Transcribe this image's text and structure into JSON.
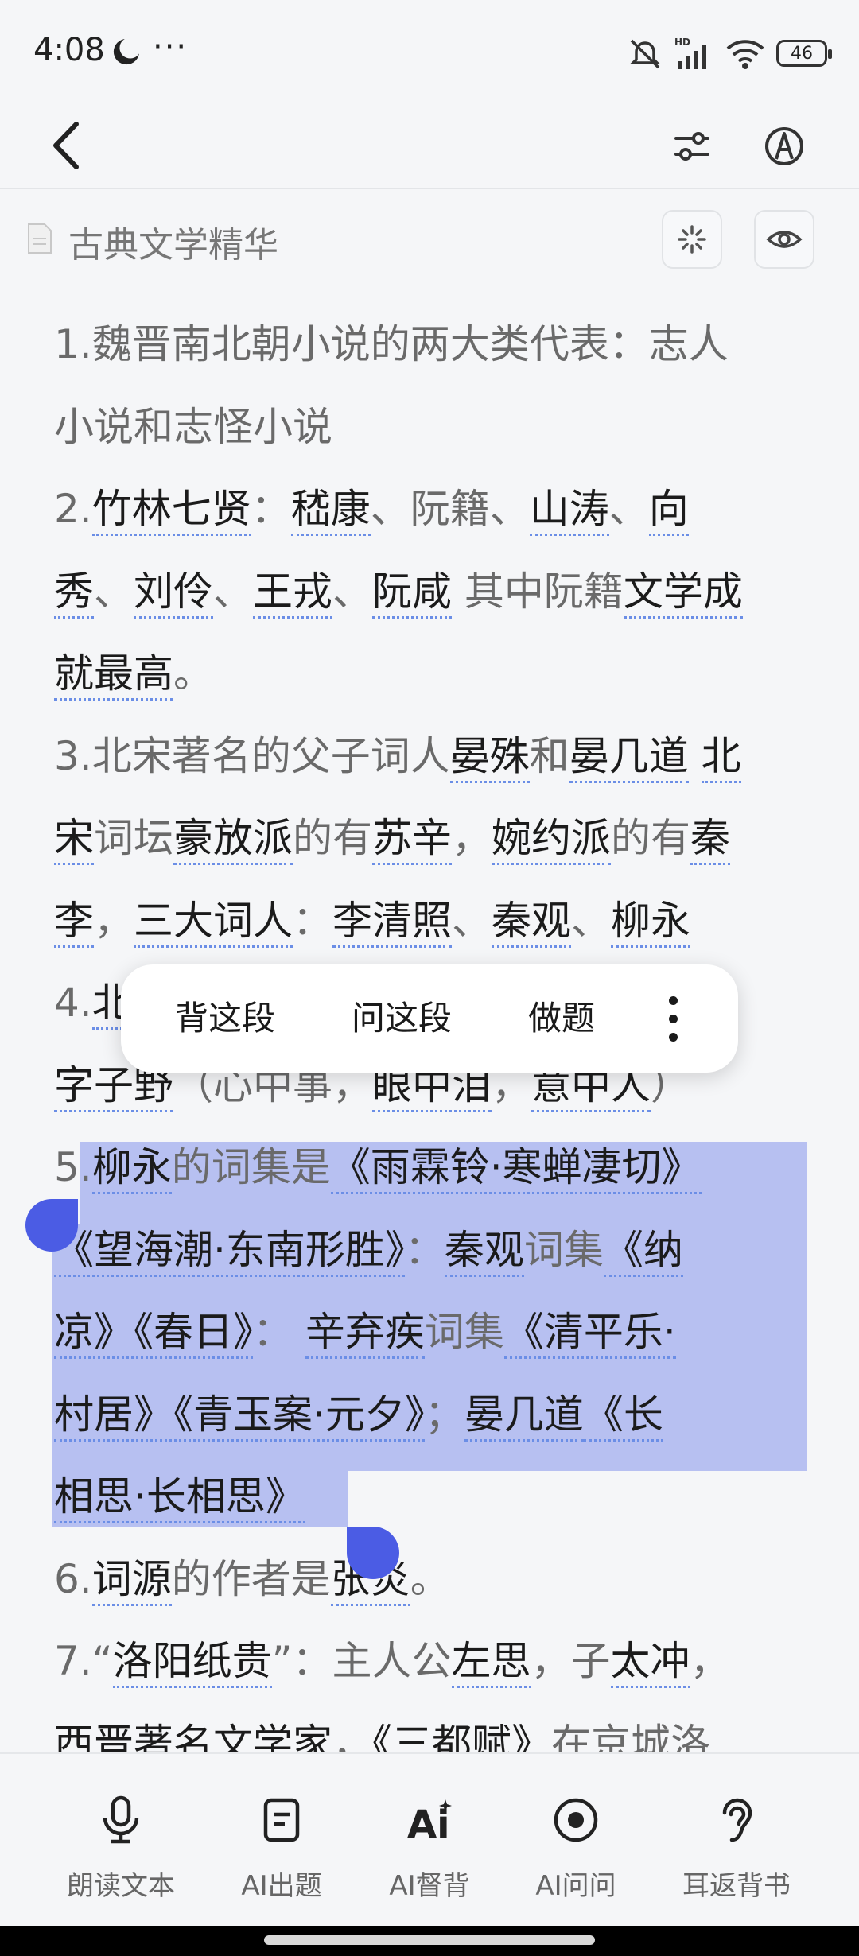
{
  "status": {
    "time": "4:08",
    "dots": "···",
    "battery": "46"
  },
  "doc": {
    "title": "古典文学精华"
  },
  "paragraphs": [
    [
      {
        "t": "1.魏晋南北朝小说的两大类代表：志人"
      }
    ],
    [
      {
        "t": "小说和志怪小说"
      }
    ],
    [
      {
        "t": "2."
      },
      {
        "t": "竹林七贤",
        "k": 1
      },
      {
        "t": "："
      },
      {
        "t": "嵇康",
        "k": 1
      },
      {
        "t": "、阮籍、"
      },
      {
        "t": "山涛",
        "k": 1
      },
      {
        "t": "、"
      },
      {
        "t": "向",
        "k": 1
      }
    ],
    [
      {
        "t": "秀",
        "k": 1
      },
      {
        "t": "、"
      },
      {
        "t": "刘伶",
        "k": 1
      },
      {
        "t": "、"
      },
      {
        "t": "王戎",
        "k": 1
      },
      {
        "t": "、"
      },
      {
        "t": "阮咸",
        "k": 1
      },
      {
        "t": " 其中阮籍"
      },
      {
        "t": "文学成",
        "k": 1
      }
    ],
    [
      {
        "t": "就最高",
        "k": 1
      },
      {
        "t": "。"
      }
    ],
    [
      {
        "t": "3.北宋著名的父子词人"
      },
      {
        "t": "晏殊",
        "k": 1
      },
      {
        "t": "和"
      },
      {
        "t": "晏几道",
        "k": 1
      },
      {
        "t": " "
      },
      {
        "t": "北",
        "k": 1
      }
    ],
    [
      {
        "t": "宋",
        "k": 1
      },
      {
        "t": "词坛"
      },
      {
        "t": "豪放派",
        "k": 1
      },
      {
        "t": "的有"
      },
      {
        "t": "苏辛",
        "k": 1
      },
      {
        "t": "，"
      },
      {
        "t": "婉约派",
        "k": 1
      },
      {
        "t": "的有"
      },
      {
        "t": "秦",
        "k": 1
      }
    ],
    [
      {
        "t": "李",
        "k": 1
      },
      {
        "t": "，"
      },
      {
        "t": "三大词人",
        "k": 1
      },
      {
        "t": "："
      },
      {
        "t": "李清照",
        "k": 1
      },
      {
        "t": "、"
      },
      {
        "t": "秦观",
        "k": 1
      },
      {
        "t": "、"
      },
      {
        "t": "柳永",
        "k": 1
      }
    ],
    [
      {
        "t": "4."
      },
      {
        "t": "北",
        "k": 1
      }
    ],
    [
      {
        "t": "字子野",
        "k": 1
      },
      {
        "t": "（心中事，"
      },
      {
        "t": "眼中泪",
        "k": 1
      },
      {
        "t": "，"
      },
      {
        "t": "意中人",
        "k": 1
      },
      {
        "t": "）"
      }
    ],
    [
      {
        "t": "5."
      },
      {
        "t": "柳永",
        "k": 1
      },
      {
        "t": "的词集是"
      },
      {
        "t": "《雨霖铃·寒蝉凄切》",
        "k": 1
      }
    ],
    [
      {
        "t": "《望海潮·东南形胜》",
        "k": 1
      },
      {
        "t": "："
      },
      {
        "t": "秦观",
        "k": 1
      },
      {
        "t": "词集"
      },
      {
        "t": "《纳",
        "k": 1
      }
    ],
    [
      {
        "t": "凉》《春日》",
        "k": 1
      },
      {
        "t": "：  "
      },
      {
        "t": "辛弃疾",
        "k": 1
      },
      {
        "t": "词集"
      },
      {
        "t": "《清平乐·",
        "k": 1
      }
    ],
    [
      {
        "t": "村居》《青玉案·元夕》",
        "k": 1
      },
      {
        "t": "；"
      },
      {
        "t": "晏几道",
        "k": 1
      },
      {
        "t": "《长",
        "k": 1
      }
    ],
    [
      {
        "t": "相思·长相思》",
        "k": 1
      }
    ],
    [
      {
        "t": "6."
      },
      {
        "t": "词源",
        "k": 1
      },
      {
        "t": "的作者是"
      },
      {
        "t": "张炎",
        "k": 1
      },
      {
        "t": "。"
      }
    ],
    [
      {
        "t": "7.“"
      },
      {
        "t": "洛阳纸贵",
        "k": 1
      },
      {
        "t": "”：主人公"
      },
      {
        "t": "左思",
        "k": 1
      },
      {
        "t": "，子"
      },
      {
        "t": "太冲",
        "k": 1
      },
      {
        "t": "，"
      }
    ],
    [
      {
        "t": "西晋著名文学家",
        "k": 1
      },
      {
        "t": "，"
      },
      {
        "t": "《三都赋》",
        "k": 1
      },
      {
        "t": "在京城洛"
      }
    ]
  ],
  "popup": {
    "recite": "背这段",
    "ask": "问这段",
    "quiz": "做题"
  },
  "tabs": [
    {
      "label": "朗读文本",
      "icon": "microphone-icon"
    },
    {
      "label": "AI出题",
      "icon": "document-icon"
    },
    {
      "label": "AI督背",
      "icon": "ai-sparkle-icon"
    },
    {
      "label": "AI问问",
      "icon": "record-icon"
    },
    {
      "label": "耳返背书",
      "icon": "ear-icon"
    }
  ],
  "colors": {
    "accent": "#4b5ce4",
    "selection": "#b3b9ef",
    "underline": "#6b8ee6"
  }
}
